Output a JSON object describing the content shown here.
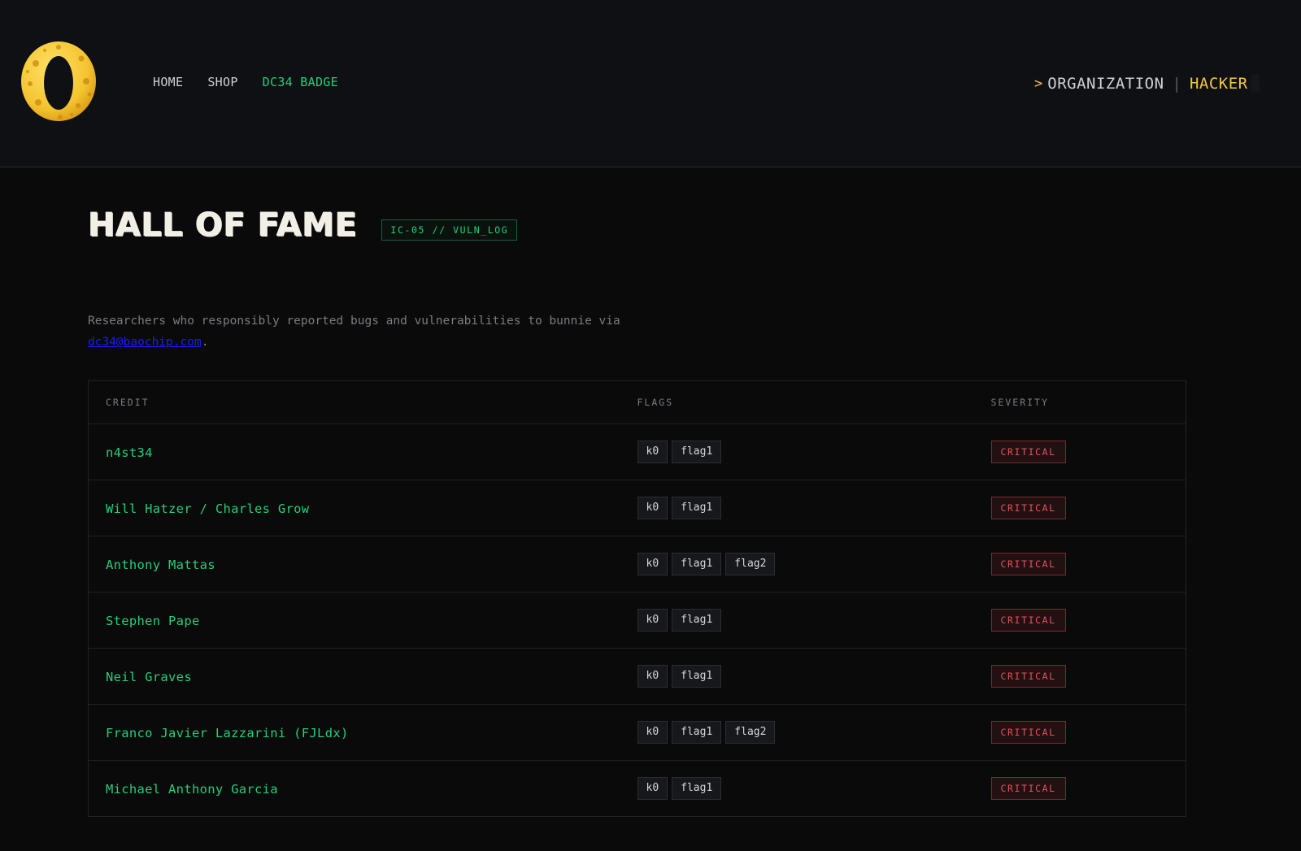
{
  "header": {
    "logo_icon": "cheese-zero-logo",
    "nav": [
      {
        "label": "HOME",
        "active": false
      },
      {
        "label": "SHOP",
        "active": false
      },
      {
        "label": "DC34 BADGE",
        "active": true
      }
    ],
    "mode": {
      "prompt": ">",
      "organization": "ORGANIZATION",
      "separator": "|",
      "hacker": "HACKER",
      "selected": "HACKER"
    }
  },
  "page": {
    "title": "HALL OF FAME",
    "tag": "IC-05 // VULN_LOG",
    "intro_text": "Researchers who responsibly reported bugs and vulnerabilities to bunnie via",
    "intro_email": "dc34@baochip.com",
    "intro_suffix": "."
  },
  "table": {
    "columns": [
      "CREDIT",
      "FLAGS",
      "SEVERITY"
    ],
    "rows": [
      {
        "credit": "n4st34",
        "flags": [
          "k0",
          "flag1"
        ],
        "severity": "CRITICAL"
      },
      {
        "credit": "Will Hatzer / Charles Grow",
        "flags": [
          "k0",
          "flag1"
        ],
        "severity": "CRITICAL"
      },
      {
        "credit": "Anthony Mattas",
        "flags": [
          "k0",
          "flag1",
          "flag2"
        ],
        "severity": "CRITICAL"
      },
      {
        "credit": "Stephen Pape",
        "flags": [
          "k0",
          "flag1"
        ],
        "severity": "CRITICAL"
      },
      {
        "credit": "Neil Graves",
        "flags": [
          "k0",
          "flag1"
        ],
        "severity": "CRITICAL"
      },
      {
        "credit": "Franco Javier Lazzarini (FJLdx)",
        "flags": [
          "k0",
          "flag1",
          "flag2"
        ],
        "severity": "CRITICAL"
      },
      {
        "credit": "Michael Anthony Garcia",
        "flags": [
          "k0",
          "flag1"
        ],
        "severity": "CRITICAL"
      }
    ]
  },
  "colors": {
    "accent_green": "#21d07a",
    "accent_yellow": "#f5c542",
    "critical_red": "#e0545a",
    "background": "#0a0a0b"
  }
}
